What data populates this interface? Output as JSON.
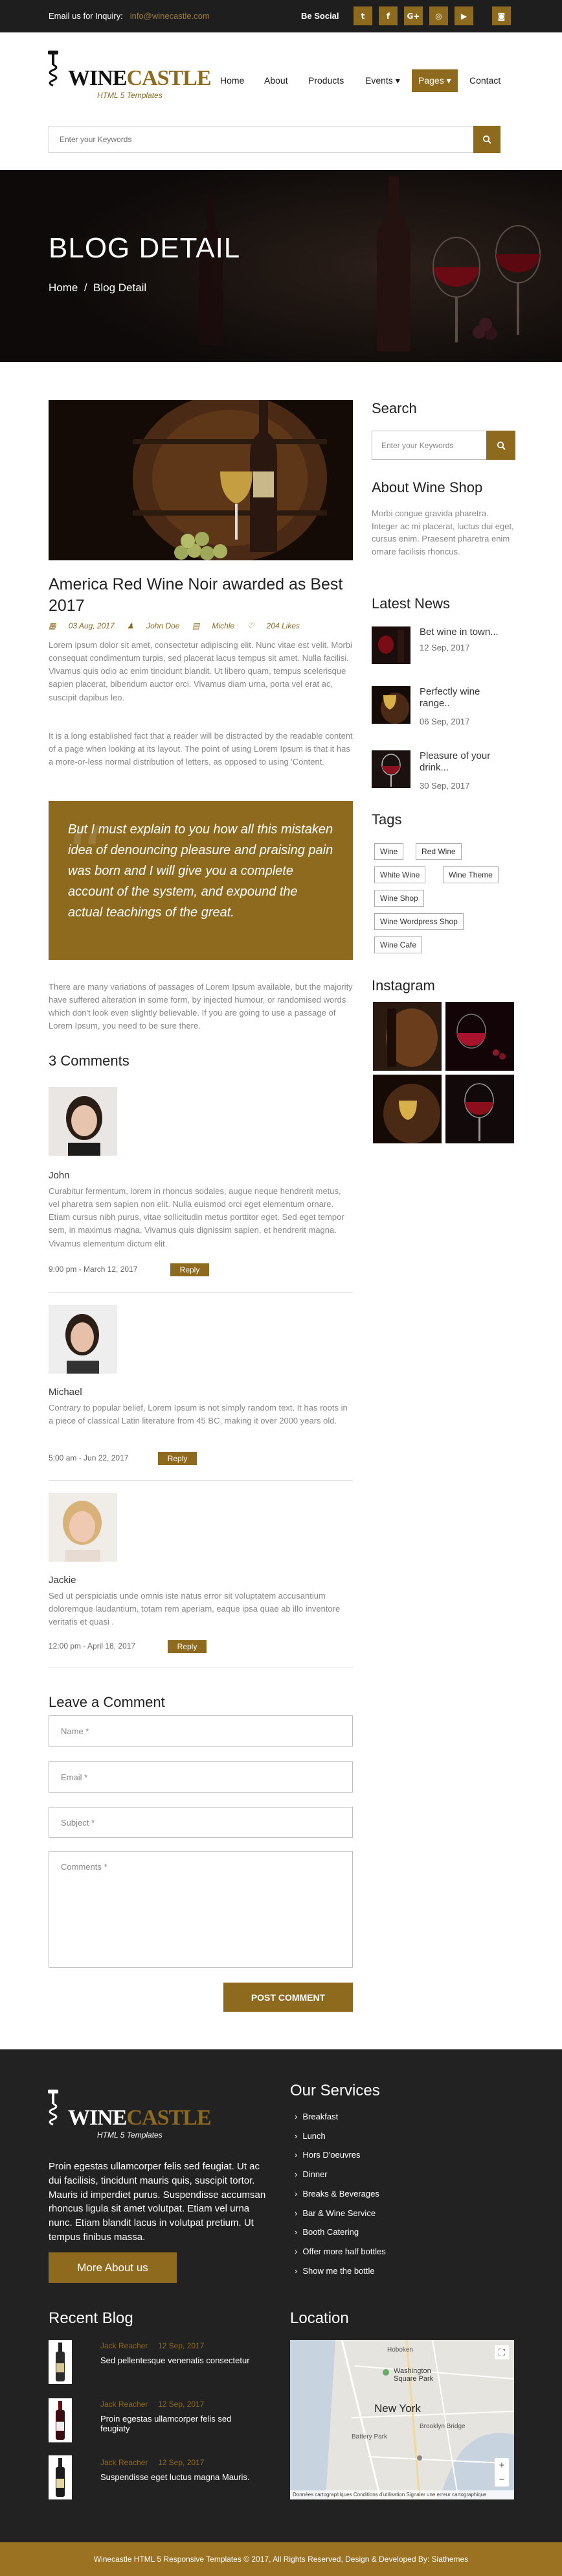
{
  "topbar": {
    "inquiry_label": "Email us for Inquiry:",
    "email": "info@winecastle.com",
    "social_label": "Be Social",
    "social_icons": [
      "twitter-icon",
      "facebook-icon",
      "google-plus-icon",
      "instagram-icon",
      "youtube-icon",
      "camera-icon"
    ],
    "social_glyphs": [
      "t",
      "f",
      "G+",
      "◎",
      "▶",
      "◙"
    ]
  },
  "brand": {
    "logo_w": "W",
    "logo_ine": "INE",
    "logo_castle": "CASTLE",
    "tagline": "HTML 5 Templates"
  },
  "nav": {
    "items": [
      "Home",
      "About",
      "Products",
      "Events ▾",
      "Pages ▾",
      "Contact"
    ],
    "active_index": 4
  },
  "search": {
    "placeholder": "Enter your Keywords"
  },
  "hero": {
    "title": "BLOG DETAIL",
    "breadcrumb_home": "Home",
    "breadcrumb_sep": "/",
    "breadcrumb_current": "Blog Detail"
  },
  "post": {
    "title": "America Red Wine Noir awarded as Best 2017",
    "date": "03 Aug, 2017",
    "author": "John Doe",
    "category": "Michle",
    "likes": "204 Likes",
    "para1": "Lorem ipsum dolor sit amet, consectetur adipiscing elit. Nunc vitae est velit. Morbi consequat condimentum turpis, sed placerat lacus tempus sit amet. Nulla facilisi. Vivamus quis odio ac enim tincidunt blandit. Ut libero quam, tempus scelerisque sapien placerat, bibendum auctor orci. Vivamus diam urna, porta vel erat ac, suscipit dapibus leo.",
    "para2": "It is a long established fact that a reader will be distracted by the readable content of a page when looking at its layout. The point of using Lorem Ipsum is that it has a more-or-less normal distribution of letters, as opposed to using 'Content.",
    "quote": "But I must explain to you how all this mistaken idea of denouncing pleasure and praising pain was born and I will give you a complete account of the system, and expound the actual teachings of the great.",
    "para3": "There are many variations of passages of Lorem Ipsum available, but the majority have suffered alteration in some form, by injected humour, or randomised words which don't look even slightly believable. If you are going to use a passage of Lorem Ipsum, you need to be sure there."
  },
  "comments": {
    "heading": "3 Comments",
    "reply_label": "Reply",
    "items": [
      {
        "name": "John",
        "text": "Curabitur fermentum, lorem in rhoncus sodales, augue neque hendrerit metus, vel pharetra sem sapien non elit. Nulla euismod orci eget elementum ornare. Etiam cursus nibh purus, vitae sollicitudin metus porttitor eget. Sed eget tempor sem, in maximus magna. Vivamus quis dignissim sapien, et hendrerit magna. Vivamus elementum dictum elit.",
        "date": "9:00 pm - March 12, 2017"
      },
      {
        "name": "Michael",
        "text": "Contrary to popular belief, Lorem Ipsum is not simply random text. It has roots in a piece of classical Latin literature from 45 BC, making it over 2000 years old.",
        "date": "5:00 am - Jun 22, 2017"
      },
      {
        "name": "Jackie",
        "text": "Sed ut perspiciatis unde omnis iste natus error sit voluptatem accusantium doloremque laudantium, totam rem aperiam, eaque ipsa quae ab illo inventore veritatis et quasi .",
        "date": "12:00 pm - April 18, 2017"
      }
    ]
  },
  "leave_comment": {
    "heading": "Leave a Comment",
    "name_placeholder": "Name *",
    "email_placeholder": "Email *",
    "subject_placeholder": "Subject *",
    "comments_placeholder": "Comments *",
    "submit_label": "POST COMMENT"
  },
  "sidebar": {
    "search_heading": "Search",
    "search_placeholder": "Enter your Keywords",
    "about_heading": "About Wine Shop",
    "about_text": "Morbi congue gravida pharetra. Integer ac mi placerat, luctus dui eget, cursus enim. Praesent pharetra enim ornare facilisis rhoncus.",
    "news_heading": "Latest News",
    "news": [
      {
        "title": "Bet wine in town...",
        "date": "12 Sep, 2017"
      },
      {
        "title": "Perfectly wine range..",
        "date": "06 Sep, 2017"
      },
      {
        "title": "Pleasure of your drink...",
        "date": "30 Sep, 2017"
      }
    ],
    "tags_heading": "Tags",
    "tags": [
      "Wine",
      "Red Wine",
      "White Wine",
      "Wine Theme",
      "Wine Shop",
      "Wine Wordpress Shop",
      "Wine Cafe"
    ],
    "instagram_heading": "Instagram"
  },
  "footer": {
    "about_text": "Proin egestas ullamcorper felis sed feugiat. Ut ac dui facilisis, tincidunt mauris quis, suscipit tortor. Mauris id imperdiet purus. Suspendisse accumsan rhoncus ligula sit amet volutpat. Etiam vel urna nunc. Etiam blandit lacus in volutpat pretium. Ut tempus finibus massa.",
    "more_label": "More About us",
    "services_heading": "Our Services",
    "services": [
      "Breakfast",
      "Lunch",
      "Hors D'oeuvres",
      "Dinner",
      "Breaks & Beverages",
      "Bar & Wine Service",
      "Booth Catering",
      "Offer more half bottles",
      "Show me the bottle"
    ],
    "recent_heading": "Recent Blog",
    "recent": [
      {
        "author": "Jack Reacher",
        "date": "12 Sep, 2017",
        "title": "Sed pellentesque venenatis consectetur"
      },
      {
        "author": "Jack Reacher",
        "date": "12 Sep, 2017",
        "title": "Proin egestas ullamcorper felis sed feugiaty"
      },
      {
        "author": "Jack Reacher",
        "date": "12 Sep, 2017",
        "title": "Suspendisse eget luctus magna Mauris."
      }
    ],
    "location_heading": "Location",
    "map_labels": {
      "city": "New York",
      "park": "Washington Square Park",
      "hoboken": "Hoboken",
      "battery": "Battery Park",
      "bridge": "Brooklyn Bridge",
      "attrib": "Données cartographiques   Conditions d'utilisation   Signaler une erreur cartographique"
    },
    "copyright": "Winecastle HTML 5 Responsive Templates © 2017, All Rights Reserved, Design & Developed By: Siathemes"
  }
}
